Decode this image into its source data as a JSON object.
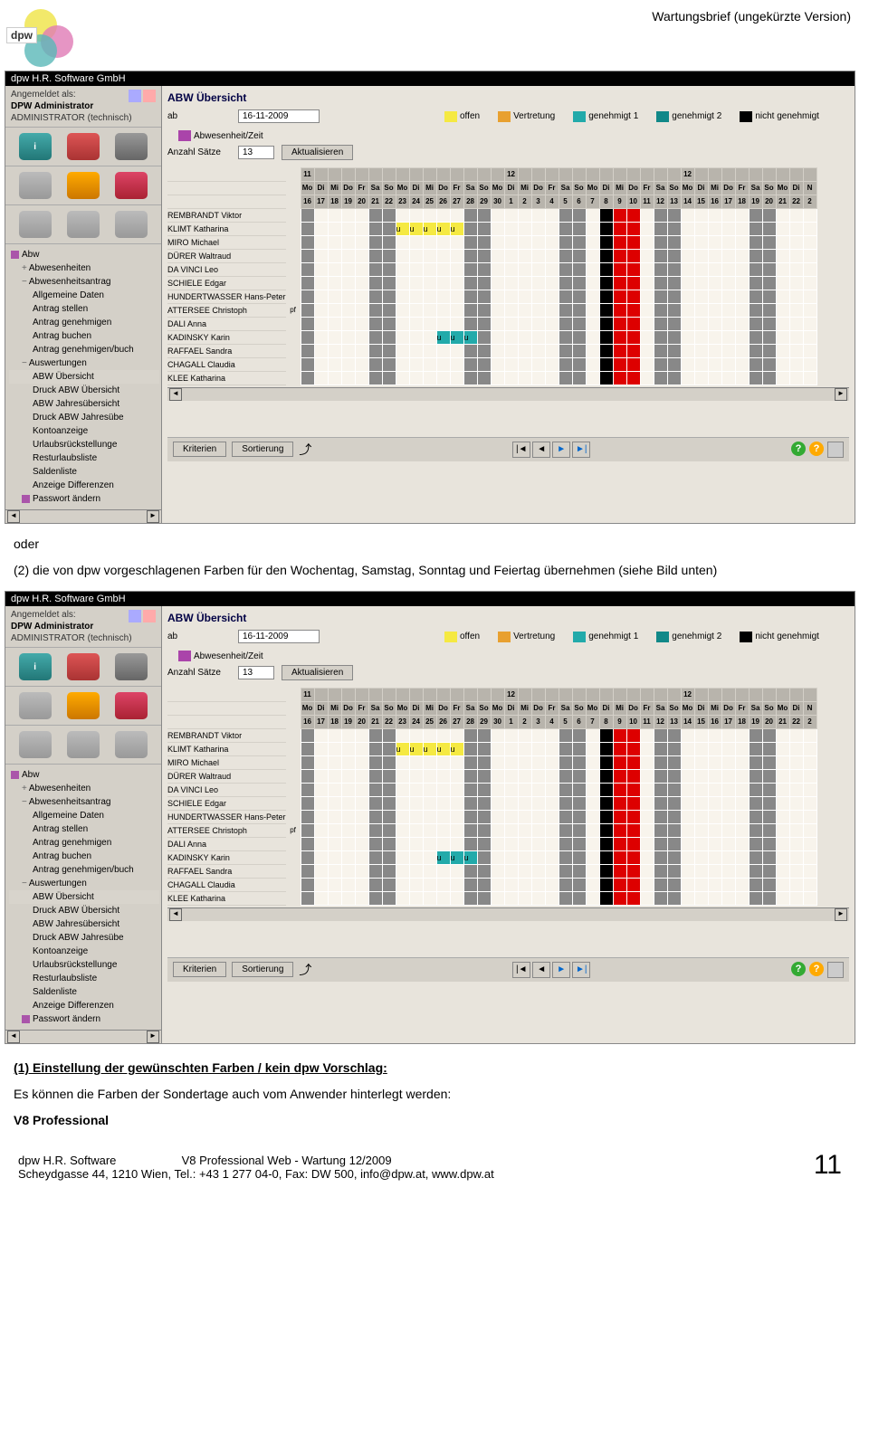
{
  "header": {
    "logo_text": "dpw",
    "doc_title": "Wartungsbrief (ungekürzte Version)"
  },
  "app": {
    "titlebar": "dpw H.R. Software GmbH",
    "user": {
      "label": "Angemeldet als:",
      "name": "DPW Administrator",
      "role": "ADMINISTRATOR (technisch)"
    },
    "tree": [
      {
        "l": 1,
        "t": "Abw",
        "sq": 1
      },
      {
        "l": 2,
        "t": "Abwesenheiten",
        "exp": "+"
      },
      {
        "l": 2,
        "t": "Abwesenheitsantrag",
        "exp": "−"
      },
      {
        "l": 3,
        "t": "Allgemeine Daten"
      },
      {
        "l": 3,
        "t": "Antrag stellen"
      },
      {
        "l": 3,
        "t": "Antrag genehmigen"
      },
      {
        "l": 3,
        "t": "Antrag buchen"
      },
      {
        "l": 3,
        "t": "Antrag genehmigen/buch"
      },
      {
        "l": 2,
        "t": "Auswertungen",
        "exp": "−"
      },
      {
        "l": 3,
        "t": "ABW Übersicht",
        "sel": 1
      },
      {
        "l": 3,
        "t": "Druck ABW Übersicht"
      },
      {
        "l": 3,
        "t": "ABW Jahresübersicht"
      },
      {
        "l": 3,
        "t": "Druck ABW Jahresübe"
      },
      {
        "l": 3,
        "t": "Kontoanzeige"
      },
      {
        "l": 3,
        "t": "Urlaubsrückstellunge"
      },
      {
        "l": 3,
        "t": "Resturlaubsliste"
      },
      {
        "l": 3,
        "t": "Saldenliste"
      },
      {
        "l": 3,
        "t": "Anzeige Differenzen"
      },
      {
        "l": 2,
        "t": "Passwort ändern",
        "sq": 1
      }
    ],
    "main": {
      "title": "ABW Übersicht",
      "filter": {
        "ab_label": "ab",
        "ab_value": "16-11-2009",
        "anzahl_label": "Anzahl Sätze",
        "anzahl_value": "13",
        "aktualisieren": "Aktualisieren"
      },
      "legend": [
        {
          "color": "yellow",
          "label": "offen"
        },
        {
          "color": "orange",
          "label": "Vertretung"
        },
        {
          "color": "teal",
          "label": "genehmigt 1"
        },
        {
          "color": "teal2",
          "label": "genehmigt 2"
        },
        {
          "color": "black",
          "label": "nicht genehmigt"
        },
        {
          "color": "purple",
          "label": "Abwesenheit/Zeit"
        }
      ],
      "months": [
        "11",
        "",
        "",
        "",
        "",
        "",
        "",
        "",
        "",
        "",
        "",
        "",
        "",
        "",
        "",
        "12",
        "",
        "",
        "",
        "",
        "",
        "",
        "",
        "",
        "",
        "",
        "",
        "",
        "12",
        "",
        "",
        "",
        "",
        "",
        "",
        "",
        "",
        ""
      ],
      "days": [
        "Mo",
        "Di",
        "Mi",
        "Do",
        "Fr",
        "Sa",
        "So",
        "Mo",
        "Di",
        "Mi",
        "Do",
        "Fr",
        "Sa",
        "So",
        "Mo",
        "Di",
        "Mi",
        "Do",
        "Fr",
        "Sa",
        "So",
        "Mo",
        "Di",
        "Mi",
        "Do",
        "Fr",
        "Sa",
        "So",
        "Mo",
        "Di",
        "Mi",
        "Do",
        "Fr",
        "Sa",
        "So",
        "Mo",
        "Di",
        "N"
      ],
      "nums": [
        "16",
        "17",
        "18",
        "19",
        "20",
        "21",
        "22",
        "23",
        "24",
        "25",
        "26",
        "27",
        "28",
        "29",
        "30",
        "1",
        "2",
        "3",
        "4",
        "5",
        "6",
        "7",
        "8",
        "9",
        "10",
        "11",
        "12",
        "13",
        "14",
        "15",
        "16",
        "17",
        "18",
        "19",
        "20",
        "21",
        "22",
        "2"
      ],
      "employees": [
        {
          "name": "REMBRANDT Viktor",
          "code": ""
        },
        {
          "name": "KLIMT Katharina",
          "code": ""
        },
        {
          "name": "MIRO Michael",
          "code": ""
        },
        {
          "name": "DÜRER Waltraud",
          "code": ""
        },
        {
          "name": "DA VINCI Leo",
          "code": ""
        },
        {
          "name": "SCHIELE Edgar",
          "code": ""
        },
        {
          "name": "HUNDERTWASSER Hans-Peter",
          "code": ""
        },
        {
          "name": "ATTERSEE Christoph",
          "code": "pf"
        },
        {
          "name": "DALI Anna",
          "code": ""
        },
        {
          "name": "KADINSKY Karin",
          "code": ""
        },
        {
          "name": "RAFFAEL Sandra",
          "code": ""
        },
        {
          "name": "CHAGALL Claudia",
          "code": ""
        },
        {
          "name": "KLEE Katharina",
          "code": ""
        }
      ],
      "bottom": {
        "kriterien": "Kriterien",
        "sortierung": "Sortierung"
      }
    }
  },
  "body_text": {
    "p1": "oder",
    "p2": "(2) die von dpw vorgeschlagenen Farben für den Wochentag, Samstag, Sonntag und Feiertag übernehmen (siehe Bild unten)",
    "p3": "(1) Einstellung der gewünschten Farben / kein dpw Vorschlag:",
    "p4": "Es können die Farben der Sondertage auch vom Anwender hinterlegt werden:",
    "p5": "V8 Professional"
  },
  "footer": {
    "left1": "dpw H.R. Software",
    "left2": "Scheydgasse 44, 1210 Wien, Tel.: +43 1 277 04-0, Fax: DW 500, info@dpw.at, www.dpw.at",
    "center": "V8 Professional Web - Wartung 12/2009",
    "page": "11"
  },
  "grid_pattern": {
    "weekend_cols": [
      5,
      6,
      12,
      13,
      19,
      20,
      26,
      27,
      33,
      34
    ],
    "black_cols": [
      22
    ],
    "red_cols": [
      23,
      24
    ],
    "klimt_u": [
      7,
      8,
      9,
      10,
      11
    ],
    "kadinsky_u": [
      10,
      11,
      12
    ]
  }
}
